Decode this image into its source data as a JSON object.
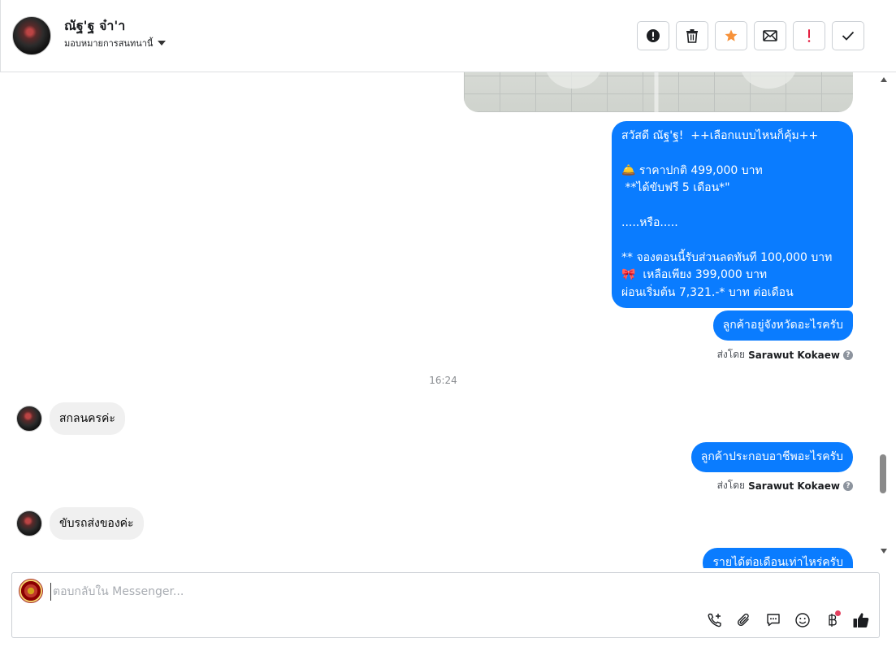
{
  "header": {
    "contact_name": "ณัฐ'ฐ จ๋า'า",
    "assign_label": "มอบหมายการสนทนานี้",
    "actions": [
      {
        "name": "spam-button",
        "icon": "exclamation-circle-icon"
      },
      {
        "name": "delete-button",
        "icon": "trash-icon"
      },
      {
        "name": "star-button",
        "icon": "star-icon"
      },
      {
        "name": "mark-unread-button",
        "icon": "envelope-icon"
      },
      {
        "name": "follow-up-button",
        "icon": "exclamation-icon"
      },
      {
        "name": "done-button",
        "icon": "check-icon"
      }
    ]
  },
  "colors": {
    "outgoing_bubble": "#0a7cff",
    "incoming_bubble": "#f0f0f0",
    "star": "#f7923a",
    "alert_red": "#e41e3f"
  },
  "messages": {
    "offer": "สวัสดี ณัฐ'ฐ!  ++เลือกแบบไหนก็คุ้ม++\n\n🛎️ ราคาปกติ 499,000 บาท\n **ได้ขับฟรี 5 เดือน*\"\n\n.....หรือ.....\n\n** จองตอนนี้รับส่วนลดทันที 100,000 บาท\n🎀  เหลือเพียง 399,000 บาท\nผ่อนเริ่มต้น 7,321.-* บาท ต่อเดือน",
    "question1": "ลูกค้าอยู่จังหวัดอะไรครับ",
    "sent_by_prefix": "ส่งโดย",
    "sent_by_name": "Sarawut Kokaew",
    "timestamp": "16:24",
    "reply1": "สกลนครค่ะ",
    "question2": "ลูกค้าประกอบอาชีพอะไรครับ",
    "reply2": "ขับรถส่งของค่ะ",
    "question3": "รายได้ต่อเดือนเท่าไหร่ครับ"
  },
  "composer": {
    "placeholder": "ตอบกลับใน Messenger...",
    "tools": [
      "call-add-icon",
      "paperclip-icon",
      "chat-bubble-icon",
      "smiley-icon",
      "baht-icon",
      "thumbs-up-icon"
    ]
  }
}
